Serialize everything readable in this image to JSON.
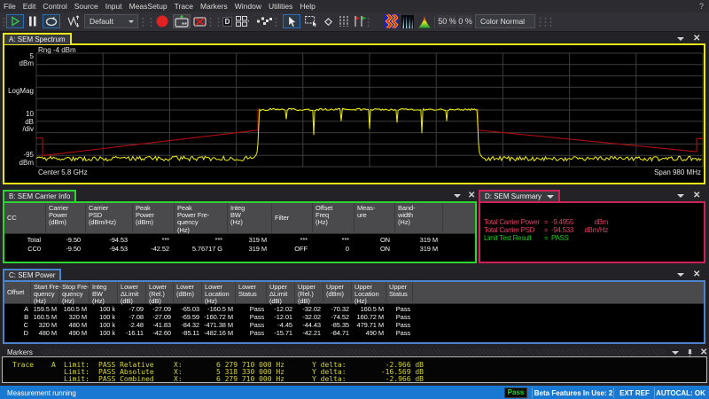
{
  "menu": {
    "items": [
      "File",
      "Edit",
      "Control",
      "Source",
      "Input",
      "MeasSetup",
      "Trace",
      "Markers",
      "Window",
      "Utilities",
      "Help"
    ],
    "help_mark": "?"
  },
  "toolbar": {
    "preset_combo": "Default",
    "zoom_percent": "50 %",
    "pan_percent": "0 %",
    "color_combo": "Color Normal",
    "d_badge": "D"
  },
  "spectrum": {
    "tab": "A: SEM Spectrum",
    "accent": "#e9e715",
    "range_label": "Rng -4 dBm",
    "y_top": "5",
    "y_top_unit": "dBm",
    "scale_label": "LogMag",
    "div_num": "10",
    "div_unit": "dB",
    "div_suffix": "/div",
    "y_bottom": "-95",
    "y_bottom_unit": "dBm",
    "center_label": "Center 5.8 GHz",
    "span_label": "Span 980 MHz"
  },
  "carrier_info": {
    "tab": "B: SEM Carrier Info",
    "accent": "#2fd32f",
    "columns": [
      "CC",
      "Carrier\nPower\n(dBm)",
      "Carrier\nPSD\n(dBm/Hz)",
      "Peak\nPower\n(dBm)",
      "Peak\nPower Fre-\nquency\n(Hz)",
      "Integ\nBW\n(Hz)",
      "Filter",
      "Offset\nFreq\n(Hz)",
      "Meas-\nure",
      "Band-\nwidth\n(Hz)"
    ],
    "rows": [
      [
        "Total",
        "-9.50",
        "-94.53",
        "***",
        "***",
        "319 M",
        "***",
        "***",
        "ON",
        "319 M"
      ],
      [
        "CC0",
        "-9.50",
        "-94.53",
        "-42.52",
        "5.76717 G",
        "319 M",
        "OFF",
        "0",
        "ON",
        "319 M"
      ]
    ]
  },
  "summary": {
    "tab": "D: SEM Summary",
    "accent": "#cc2257",
    "text_color": "#e04063",
    "pass_color": "#1ecc1e",
    "lines": [
      {
        "label": "Total Carrier Power",
        "eq": "=",
        "value": "-9.4955",
        "unit": "dBm",
        "kind": "pink"
      },
      {
        "label": "Total Carrier PSD",
        "eq": "=",
        "value": "-94.533",
        "unit": "dBm/Hz",
        "kind": "pink"
      },
      {
        "label": "Limit Test Result",
        "eq": "=",
        "value": "PASS",
        "unit": "",
        "kind": "green"
      }
    ]
  },
  "power": {
    "tab": "C: SEM Power",
    "accent": "#4a84cc",
    "columns": [
      "Offset",
      "Start Fre-\nquency\n(Hz)",
      "Stop Fre-\nquency\n(Hz)",
      "Integ\nBW\n(Hz)",
      "Lower\nΔLimit\n(dB)",
      "Lower\n(Rel.)\n(dB)",
      "Lower\n(dBm)",
      "Lower\nLocation\n(Hz)",
      "Lower\nStatus",
      "Upper\nΔLimit\n(dB)",
      "Upper\n(Rel.)\n(dB)",
      "Upper\n(dBm)",
      "Upper\nLocation\n(Hz)",
      "Upper\nStatus"
    ],
    "rows": [
      [
        "A",
        "159.5 M",
        "160.5 M",
        "100 k",
        "-7.09",
        "-27.09",
        "-65.03",
        "-160.5 M",
        "Pass",
        "-12.02",
        "-32.02",
        "-70.32",
        "160.5 M",
        "Pass"
      ],
      [
        "B",
        "160.5 M",
        "320 M",
        "100 k",
        "-7.08",
        "-27.09",
        "-69.59",
        "-160.72 M",
        "Pass",
        "-12.01",
        "-32.02",
        "-74.52",
        "160.72 M",
        "Pass"
      ],
      [
        "C",
        "320 M",
        "480 M",
        "100 k",
        "-2.48",
        "-41.83",
        "-84.32",
        "-471.38 M",
        "Pass",
        "-4.45",
        "-44.43",
        "-85.35",
        "479.71 M",
        "Pass"
      ],
      [
        "D",
        "480 M",
        "490 M",
        "100 k",
        "-16.11",
        "-42.60",
        "-85.11",
        "-482.16 M",
        "Pass",
        "-15.71",
        "-42.21",
        "-84.71",
        "490 M",
        "Pass"
      ]
    ]
  },
  "markers": {
    "title": "Markers",
    "rows": [
      [
        "Trace",
        "A",
        "Limit:",
        "PASS Relative",
        "X:",
        "6 279 710 000 Hz",
        "Y delta:",
        "-2.966 dB"
      ],
      [
        "",
        "",
        "Limit:",
        "PASS Absolute",
        "X:",
        "5 318 330 000 Hz",
        "Y delta:",
        "-16.569 dB"
      ],
      [
        "",
        "",
        "Limit:",
        "PASS Combined",
        "X:",
        "6 279 710 000 Hz",
        "Y delta:",
        "-2.966 dB"
      ]
    ]
  },
  "status_bar": {
    "left_text": "Measurement running",
    "pass_badge": "Pass",
    "right_items": [
      "Beta Features In Use: 2",
      "EXT REF",
      "AUTOCAL: OK"
    ],
    "bar_color": "#1878d2"
  },
  "chart_data": {
    "type": "line",
    "title": "A: SEM Spectrum",
    "x_axis": {
      "center": "5.8 GHz",
      "span": "980 MHz"
    },
    "y_axis": {
      "top_dbm": 5,
      "bottom_dbm": -95,
      "db_per_div": 10,
      "scale": "LogMag",
      "range_dbm": -4
    },
    "grid": {
      "cols": 10,
      "rows": 10,
      "color": "#3d3d3d"
    },
    "trace": {
      "name": "yellow-trace",
      "color": "#f2ee0e",
      "noise_floor_dbm": -87.8,
      "noise_pp_db": 4.2,
      "carrier_level_dbm": -44.6,
      "carrier_noise_pp_db": 2.0,
      "carrier_start_frac": 0.3351,
      "carrier_end_frac": 0.6609,
      "notches": [
        {
          "frac": 0.375,
          "dbm": -53.1
        },
        {
          "frac": 0.4162,
          "dbm": -67.1
        },
        {
          "frac": 0.4574,
          "dbm": -54.7
        },
        {
          "frac": 0.5,
          "dbm": -61.6
        },
        {
          "frac": 0.5412,
          "dbm": -56.2
        },
        {
          "frac": 0.5784,
          "dbm": -65.5
        },
        {
          "frac": 0.6157,
          "dbm": -54.7
        }
      ]
    },
    "limit_line": {
      "name": "sem-mask",
      "color": "#b00d10",
      "left_segments": [
        [
          0.0,
          -69.8
        ],
        [
          0.0093,
          -69.8
        ],
        [
          0.0093,
          -85.3
        ],
        [
          0.3325,
          -62.8
        ],
        [
          0.3325,
          -43.8
        ]
      ],
      "right_segments": [
        [
          0.663,
          -43.8
        ],
        [
          0.663,
          -62.8
        ],
        [
          0.9907,
          -81.8
        ],
        [
          0.9907,
          -70.2
        ],
        [
          1.0,
          -70.2
        ]
      ]
    }
  }
}
